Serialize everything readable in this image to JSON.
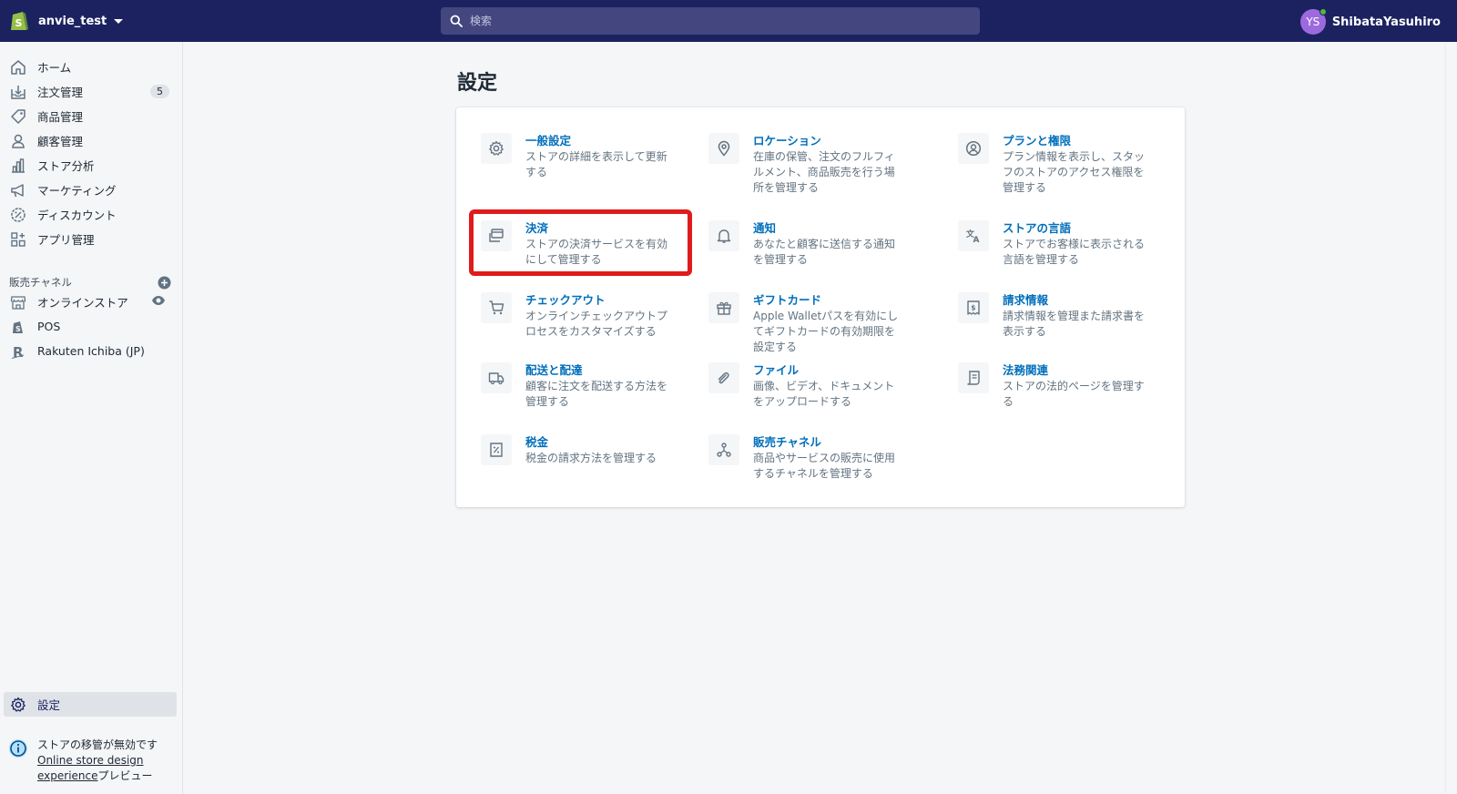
{
  "topbar": {
    "store_name": "anvie_test",
    "search_placeholder": "検索",
    "user_initials": "YS",
    "user_name": "ShibataYasuhiro"
  },
  "sidebar": {
    "items": [
      {
        "label": "ホーム",
        "icon": "home-icon"
      },
      {
        "label": "注文管理",
        "icon": "orders-icon",
        "badge": "5"
      },
      {
        "label": "商品管理",
        "icon": "tag-icon"
      },
      {
        "label": "顧客管理",
        "icon": "customer-icon"
      },
      {
        "label": "ストア分析",
        "icon": "analytics-icon"
      },
      {
        "label": "マーケティング",
        "icon": "megaphone-icon"
      },
      {
        "label": "ディスカウント",
        "icon": "discount-icon"
      },
      {
        "label": "アプリ管理",
        "icon": "apps-icon"
      }
    ],
    "channels_heading": "販売チャネル",
    "channels": [
      {
        "label": "オンラインストア",
        "icon": "store-icon"
      },
      {
        "label": "POS",
        "icon": "pos-icon"
      },
      {
        "label": "Rakuten Ichiba (JP)",
        "icon": "rakuten-icon"
      }
    ],
    "settings_label": "設定",
    "notice": {
      "text": "ストアの移管が無効です",
      "link1": "Online store design",
      "link2": "experience",
      "suffix": "プレビュー"
    }
  },
  "main": {
    "title": "設定",
    "items": [
      {
        "title": "一般設定",
        "desc": "ストアの詳細を表示して更新する",
        "icon": "gear-icon"
      },
      {
        "title": "ロケーション",
        "desc": "在庫の保管、注文のフルフィルメント、商品販売を行う場所を管理する",
        "icon": "location-pin-icon"
      },
      {
        "title": "プランと権限",
        "desc": "プラン情報を表示し、スタッフのストアのアクセス権限を管理する",
        "icon": "user-circle-icon"
      },
      {
        "title": "決済",
        "desc": "ストアの決済サービスを有効にして管理する",
        "icon": "payment-icon"
      },
      {
        "title": "通知",
        "desc": "あなたと顧客に送信する通知を管理する",
        "icon": "bell-icon"
      },
      {
        "title": "ストアの言語",
        "desc": "ストアでお客様に表示される言語を管理する",
        "icon": "translate-icon"
      },
      {
        "title": "チェックアウト",
        "desc": "オンラインチェックアウトプロセスをカスタマイズする",
        "icon": "cart-icon"
      },
      {
        "title": "ギフトカード",
        "desc": "Apple Walletパスを有効にしてギフトカードの有効期限を設定する",
        "icon": "gift-icon"
      },
      {
        "title": "請求情報",
        "desc": "請求情報を管理また請求書を表示する",
        "icon": "billing-icon"
      },
      {
        "title": "配送と配達",
        "desc": "顧客に注文を配送する方法を管理する",
        "icon": "truck-icon"
      },
      {
        "title": "ファイル",
        "desc": "画像、ビデオ、ドキュメントをアップロードする",
        "icon": "paperclip-icon"
      },
      {
        "title": "法務関連",
        "desc": "ストアの法的ページを管理する",
        "icon": "legal-icon"
      },
      {
        "title": "税金",
        "desc": "税金の請求方法を管理する",
        "icon": "tax-icon"
      },
      {
        "title": "販売チャネル",
        "desc": "商品やサービスの販売に使用するチャネルを管理する",
        "icon": "channels-icon"
      }
    ]
  },
  "colors": {
    "topbar": "#1c2260",
    "link": "#006fbb",
    "highlight": "#e01b1b",
    "avatar": "#9c6ade"
  }
}
